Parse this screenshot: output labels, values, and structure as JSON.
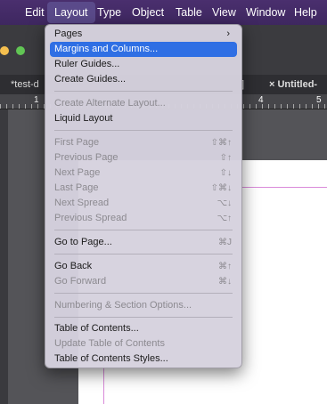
{
  "menubar": {
    "items": [
      {
        "label": "Edit"
      },
      {
        "label": "Layout"
      },
      {
        "label": "Type"
      },
      {
        "label": "Object"
      },
      {
        "label": "Table"
      },
      {
        "label": "View"
      },
      {
        "label": "Window"
      },
      {
        "label": "Help"
      }
    ],
    "active_item": "Layout"
  },
  "tabs": [
    {
      "label": "*test-d"
    },
    {
      "label": "]"
    },
    {
      "label": "× Untitled-"
    }
  ],
  "ruler": {
    "numbers": [
      "1",
      "4",
      "5"
    ]
  },
  "layout_menu": {
    "items": [
      {
        "label": "Pages",
        "shortcut": "",
        "submenu": true,
        "enabled": true
      },
      {
        "label": "Margins and Columns...",
        "shortcut": "",
        "enabled": true,
        "selected": true
      },
      {
        "label": "Ruler Guides...",
        "shortcut": "",
        "enabled": true
      },
      {
        "label": "Create Guides...",
        "shortcut": "",
        "enabled": true
      },
      {
        "label": "Create Alternate Layout...",
        "shortcut": "",
        "enabled": false
      },
      {
        "label": "Liquid Layout",
        "shortcut": "",
        "enabled": true
      },
      {
        "label": "First Page",
        "shortcut": "⇧⌘↑",
        "enabled": false
      },
      {
        "label": "Previous Page",
        "shortcut": "⇧↑",
        "enabled": false
      },
      {
        "label": "Next Page",
        "shortcut": "⇧↓",
        "enabled": false
      },
      {
        "label": "Last Page",
        "shortcut": "⇧⌘↓",
        "enabled": false
      },
      {
        "label": "Next Spread",
        "shortcut": "⌥↓",
        "enabled": false
      },
      {
        "label": "Previous Spread",
        "shortcut": "⌥↑",
        "enabled": false
      },
      {
        "label": "Go to Page...",
        "shortcut": "⌘J",
        "enabled": true
      },
      {
        "label": "Go Back",
        "shortcut": "⌘↑",
        "enabled": true
      },
      {
        "label": "Go Forward",
        "shortcut": "⌘↓",
        "enabled": false
      },
      {
        "label": "Numbering & Section Options...",
        "shortcut": "",
        "enabled": false
      },
      {
        "label": "Table of Contents...",
        "shortcut": "",
        "enabled": true
      },
      {
        "label": "Update Table of Contents",
        "shortcut": "",
        "enabled": false
      },
      {
        "label": "Table of Contents Styles...",
        "shortcut": "",
        "enabled": true
      }
    ],
    "submenu_glyph": "›"
  },
  "colors": {
    "menubar_bg": "#3e2760",
    "menu_bg": "#d6d2de",
    "highlight": "#2f6fe4",
    "guide": "#d98ad9"
  }
}
